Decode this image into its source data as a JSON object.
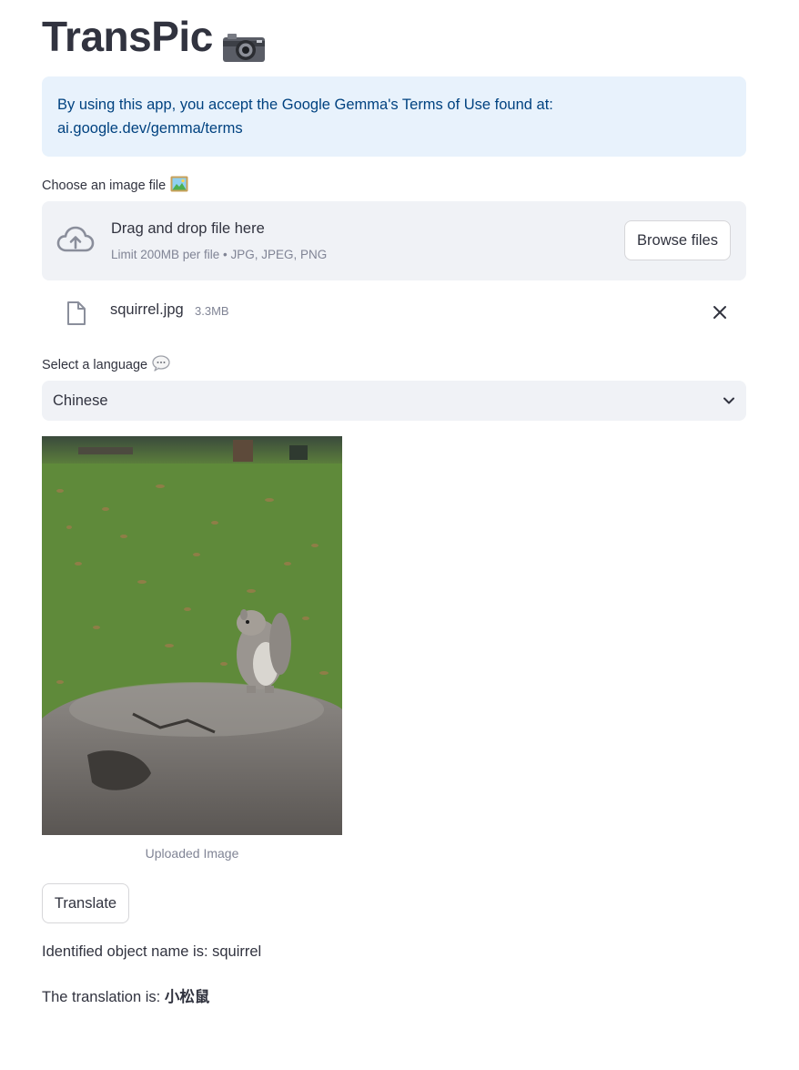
{
  "app": {
    "title": "TransPic",
    "title_icon": "camera-icon"
  },
  "notice": {
    "text": "By using this app, you accept the Google Gemma's Terms of Use found at: ai.google.dev/gemma/terms"
  },
  "uploader": {
    "label": "Choose an image file",
    "label_icon": "framed-picture-icon",
    "drop_title": "Drag and drop file here",
    "drop_subtitle": "Limit 200MB per file • JPG, JPEG, PNG",
    "browse_label": "Browse files",
    "file": {
      "name": "squirrel.jpg",
      "size": "3.3MB"
    }
  },
  "language": {
    "label": "Select a language",
    "label_icon": "speech-bubble-icon",
    "selected": "Chinese"
  },
  "image": {
    "caption": "Uploaded Image"
  },
  "actions": {
    "translate_label": "Translate"
  },
  "results": {
    "identified_prefix": "Identified object name is: ",
    "identified_value": "squirrel",
    "translation_prefix": "The translation is: ",
    "translation_value": "小松鼠"
  },
  "colors": {
    "info_bg": "#e8f2fc",
    "info_text": "#004280",
    "panel_bg": "#f0f2f6",
    "text": "#31333f",
    "muted": "#808495"
  }
}
